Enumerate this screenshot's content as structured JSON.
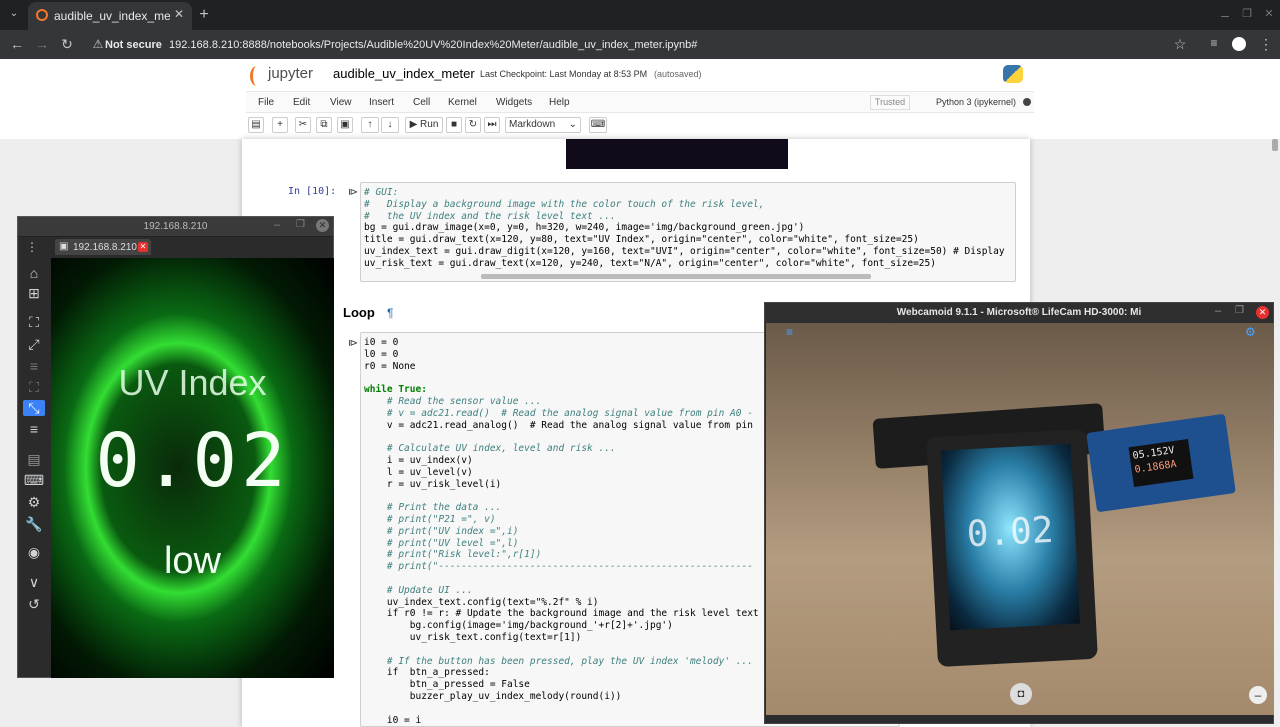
{
  "browser": {
    "tab_title": "audible_uv_index_mete",
    "security_label": "Not secure",
    "url": "192.168.8.210:8888/notebooks/Projects/Audible%20UV%20Index%20Meter/audible_uv_index_meter.ipynb#"
  },
  "jupyter": {
    "logo_text": "jupyter",
    "notebook_name": "audible_uv_index_meter",
    "checkpoint": "Last Checkpoint: Last Monday at 8:53 PM",
    "autosave": "(autosaved)",
    "menu": [
      "File",
      "Edit",
      "View",
      "Insert",
      "Cell",
      "Kernel",
      "Widgets",
      "Help"
    ],
    "trusted": "Trusted",
    "kernel": "Python 3 (ipykernel)",
    "run_label": "Run",
    "cell_type": "Markdown"
  },
  "cell1": {
    "prompt": "In [10]:",
    "lines": [
      "# GUI:",
      "#   Display a background image with the color touch of the risk level,",
      "#   the UV index and the risk level text ...",
      "bg = gui.draw_image(x=0, y=0, h=320, w=240, image='img/background_green.jpg')",
      "title = gui.draw_text(x=120, y=80, text=\"UV Index\", origin=\"center\", color=\"white\", font_size=25)",
      "uv_index_text = gui.draw_digit(x=120, y=160, text=\"UVI\", origin=\"center\", color=\"white\", font_size=50) # Display",
      "uv_risk_text = gui.draw_text(x=120, y=240, text=\"N/A\", origin=\"center\", color=\"white\", font_size=25)"
    ]
  },
  "loop_heading": "Loop",
  "pilcrow": "¶",
  "cell2": {
    "lines": [
      "i0 = 0",
      "l0 = 0",
      "r0 = None",
      "",
      "while True:",
      "    # Read the sensor value ...",
      "    # v = adc21.read()  # Read the analog signal value from pin A0 -",
      "    v = adc21.read_analog()  # Read the analog signal value from pin",
      "",
      "    # Calculate UV index, level and risk ...",
      "    i = uv_index(v)",
      "    l = uv_level(v)",
      "    r = uv_risk_level(i)",
      "",
      "    # Print the data ...",
      "    # print(\"P21 =\", v)",
      "    # print(\"UV index =\",i)",
      "    # print(\"UV level =\",l)",
      "    # print(\"Risk level:\",r[1])",
      "    # print(\"-------------------------------------------------------",
      "",
      "    # Update UI ...",
      "    uv_index_text.config(text=\"%.2f\" % i)",
      "    if r0 != r: # Update the background image and the risk level text",
      "        bg.config(image='img/background_'+r[2]+'.jpg')",
      "        uv_risk_text.config(text=r[1])",
      "",
      "    # If the button has been pressed, play the UV index 'melody' ...",
      "    if  btn_a_pressed:",
      "        btn_a_pressed = False",
      "        buzzer_play_uv_index_melody(round(i))",
      "",
      "    i0 = i"
    ]
  },
  "vnc": {
    "window_title": "192.168.8.210",
    "tab_label": "192.168.8.210",
    "screen_title": "UV Index",
    "screen_value": "0.02",
    "screen_risk": "low"
  },
  "webcam": {
    "window_title": "Webcamoid 9.1.1 - Microsoft® LifeCam HD-3000: Mi",
    "meter_voltage": "05.152V",
    "meter_current": "0.1868A",
    "device_value": "0.02"
  },
  "colors": {
    "chrome_dark": "#202124",
    "chrome_tab": "#35363a",
    "jupyter_orange": "#f37726",
    "comment": "#408080",
    "keyword": "#008000",
    "string": "#ba2121",
    "close_red": "#e8312f",
    "screen_green": "#33dd33"
  }
}
